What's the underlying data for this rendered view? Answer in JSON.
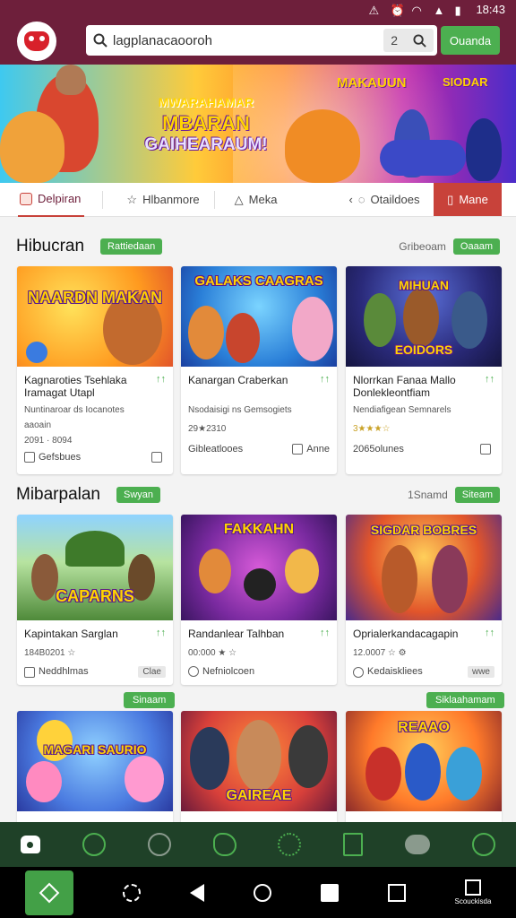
{
  "status": {
    "time": "18:43"
  },
  "header": {
    "search_value": "lagplanacaooroh",
    "clear_label": "2",
    "cta_label": "Ouanda"
  },
  "banner": {
    "title_line1": "MBARAN",
    "title_line2": "GAIHEARAUM!",
    "title_prefix": "MWARAHAMAR",
    "promo1": "MAKAUUN",
    "promo2": "SIODAR"
  },
  "tabs": [
    {
      "label": "Delpiran"
    },
    {
      "label": "Hlbanmore"
    },
    {
      "label": "Meka"
    },
    {
      "label": "Otaildoes"
    }
  ],
  "tab_action": {
    "label": "Mane"
  },
  "section1": {
    "title": "Hibucran",
    "badge": "Rattiedaan",
    "right_text": "Gribeoam",
    "right_badge": "Oaaam",
    "cards": [
      {
        "art_caption": "NAARDN MAKAN",
        "name": "Kagnaroties Tsehlaka Iramagat Utapl",
        "up": "↑↑",
        "sub1": "Nuntinaroar ds Iocanotes",
        "sub2": "aaoain",
        "rating": "2091 · 8094",
        "foot_left": "Gefsbues"
      },
      {
        "art_caption": "GALAKS CAAGRAS",
        "name": "Kanargan Craberkan",
        "up": "↑↑",
        "sub1": "Nsodaisigi ns Gemsogiets",
        "sub2": "",
        "rating": "29★2310",
        "foot_left": "Gibleatlooes",
        "foot_right": "Anne"
      },
      {
        "art_caption": "EOIDORS",
        "name": "Nlorrkan Fanaa Mallo Donlekleontfiam",
        "up": "↑↑",
        "sub1": "Nendiafigean Semnarels",
        "sub2": "",
        "rating": "3★★★☆",
        "foot_left": "2065olunes"
      }
    ]
  },
  "section2": {
    "title": "Mibarpalan",
    "badge": "Swyan",
    "right_text": "1Snamd",
    "right_badge": "Siteam",
    "cards": [
      {
        "art_caption": "CAPARNS",
        "name": "Kapintakan Sarglan",
        "up": "↑↑",
        "rating": "184B0201 ☆",
        "foot_left": "Neddhlmas",
        "foot_chip": "Clae"
      },
      {
        "art_caption": "FAKKAHN",
        "name": "Randanlear Talhban",
        "up": "↑↑",
        "rating": "00:000 ★ ☆",
        "foot_left": "Nefniolcoen"
      },
      {
        "art_caption": "SIGDAR BOBRES",
        "name": "Oprialerkandacagapin",
        "up": "↑↑",
        "rating": "12.0007 ☆ ⚙",
        "foot_left": "Kedaiskliees",
        "foot_chip": "wwe"
      }
    ]
  },
  "section3": {
    "badge_left": "Sinaam",
    "badge_right": "Siklaahamam",
    "cards": [
      {
        "art_caption": "MAGARI SAURIO"
      },
      {
        "art_caption": "GAIREAE"
      },
      {
        "art_caption": "REAAO"
      }
    ]
  },
  "bottom_nav": [
    "home-icon",
    "leaf-icon",
    "chat-icon",
    "hand-icon",
    "settings-icon",
    "book-icon",
    "cloud-icon",
    "pin-icon"
  ],
  "system_bar": {
    "last_label": "Scouckisda"
  }
}
